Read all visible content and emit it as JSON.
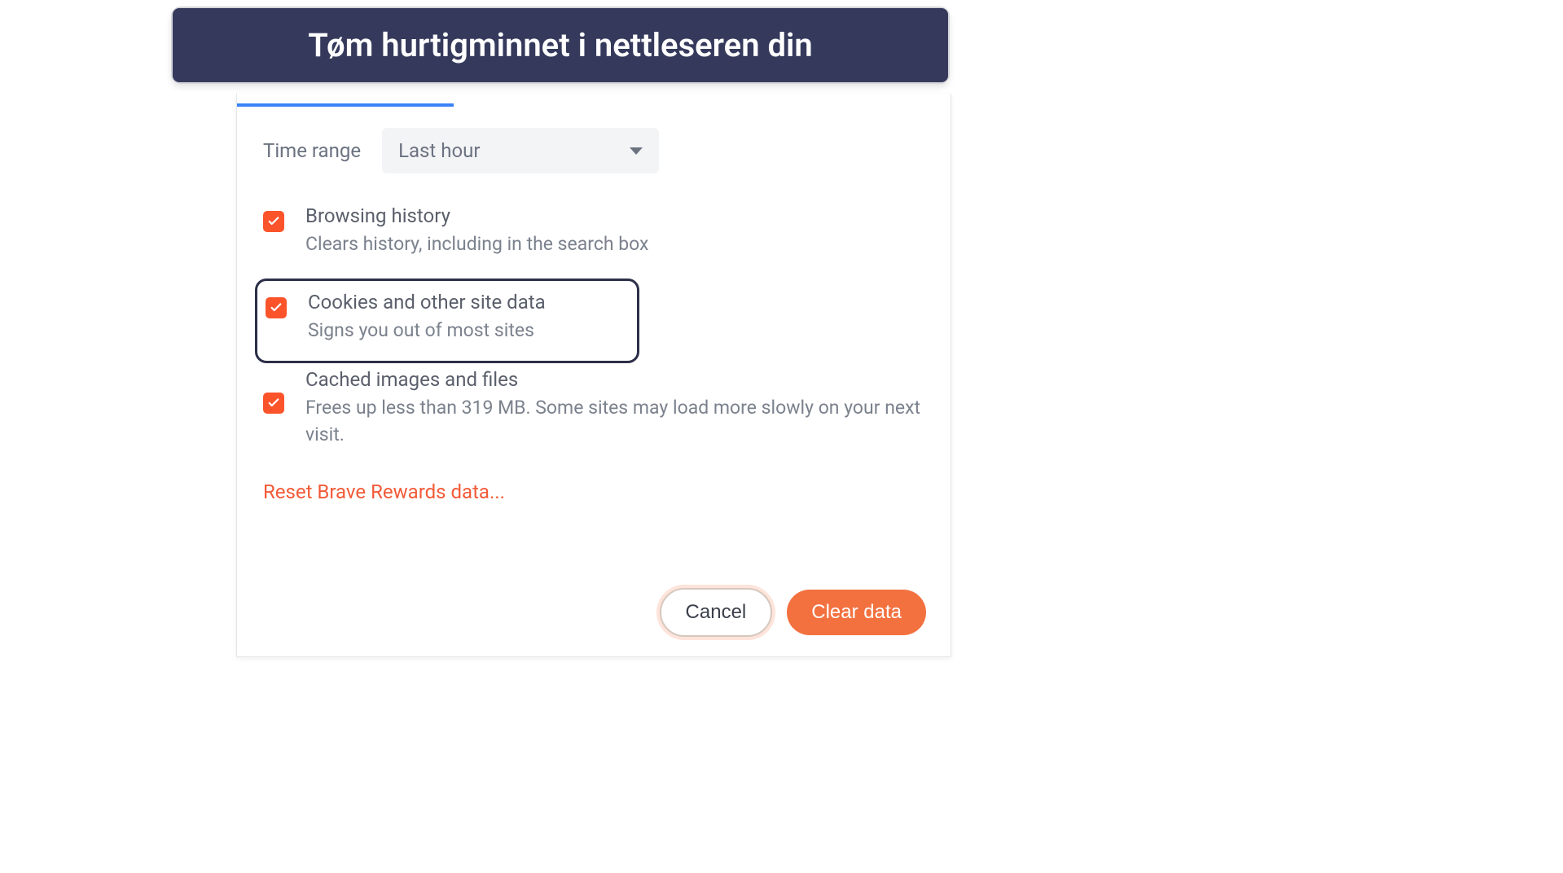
{
  "banner": {
    "title": "Tøm hurtigminnet i nettleseren din"
  },
  "dialog": {
    "time_range": {
      "label": "Time range",
      "value": "Last hour"
    },
    "options": [
      {
        "title": "Browsing history",
        "desc": "Clears history, including in the search box"
      },
      {
        "title": "Cookies and other site data",
        "desc": "Signs you out of most sites"
      },
      {
        "title": "Cached images and files",
        "desc": "Frees up less than 319 MB. Some sites may load more slowly on your next visit."
      }
    ],
    "reset_link": "Reset Brave Rewards data...",
    "buttons": {
      "cancel": "Cancel",
      "clear": "Clear data"
    }
  }
}
